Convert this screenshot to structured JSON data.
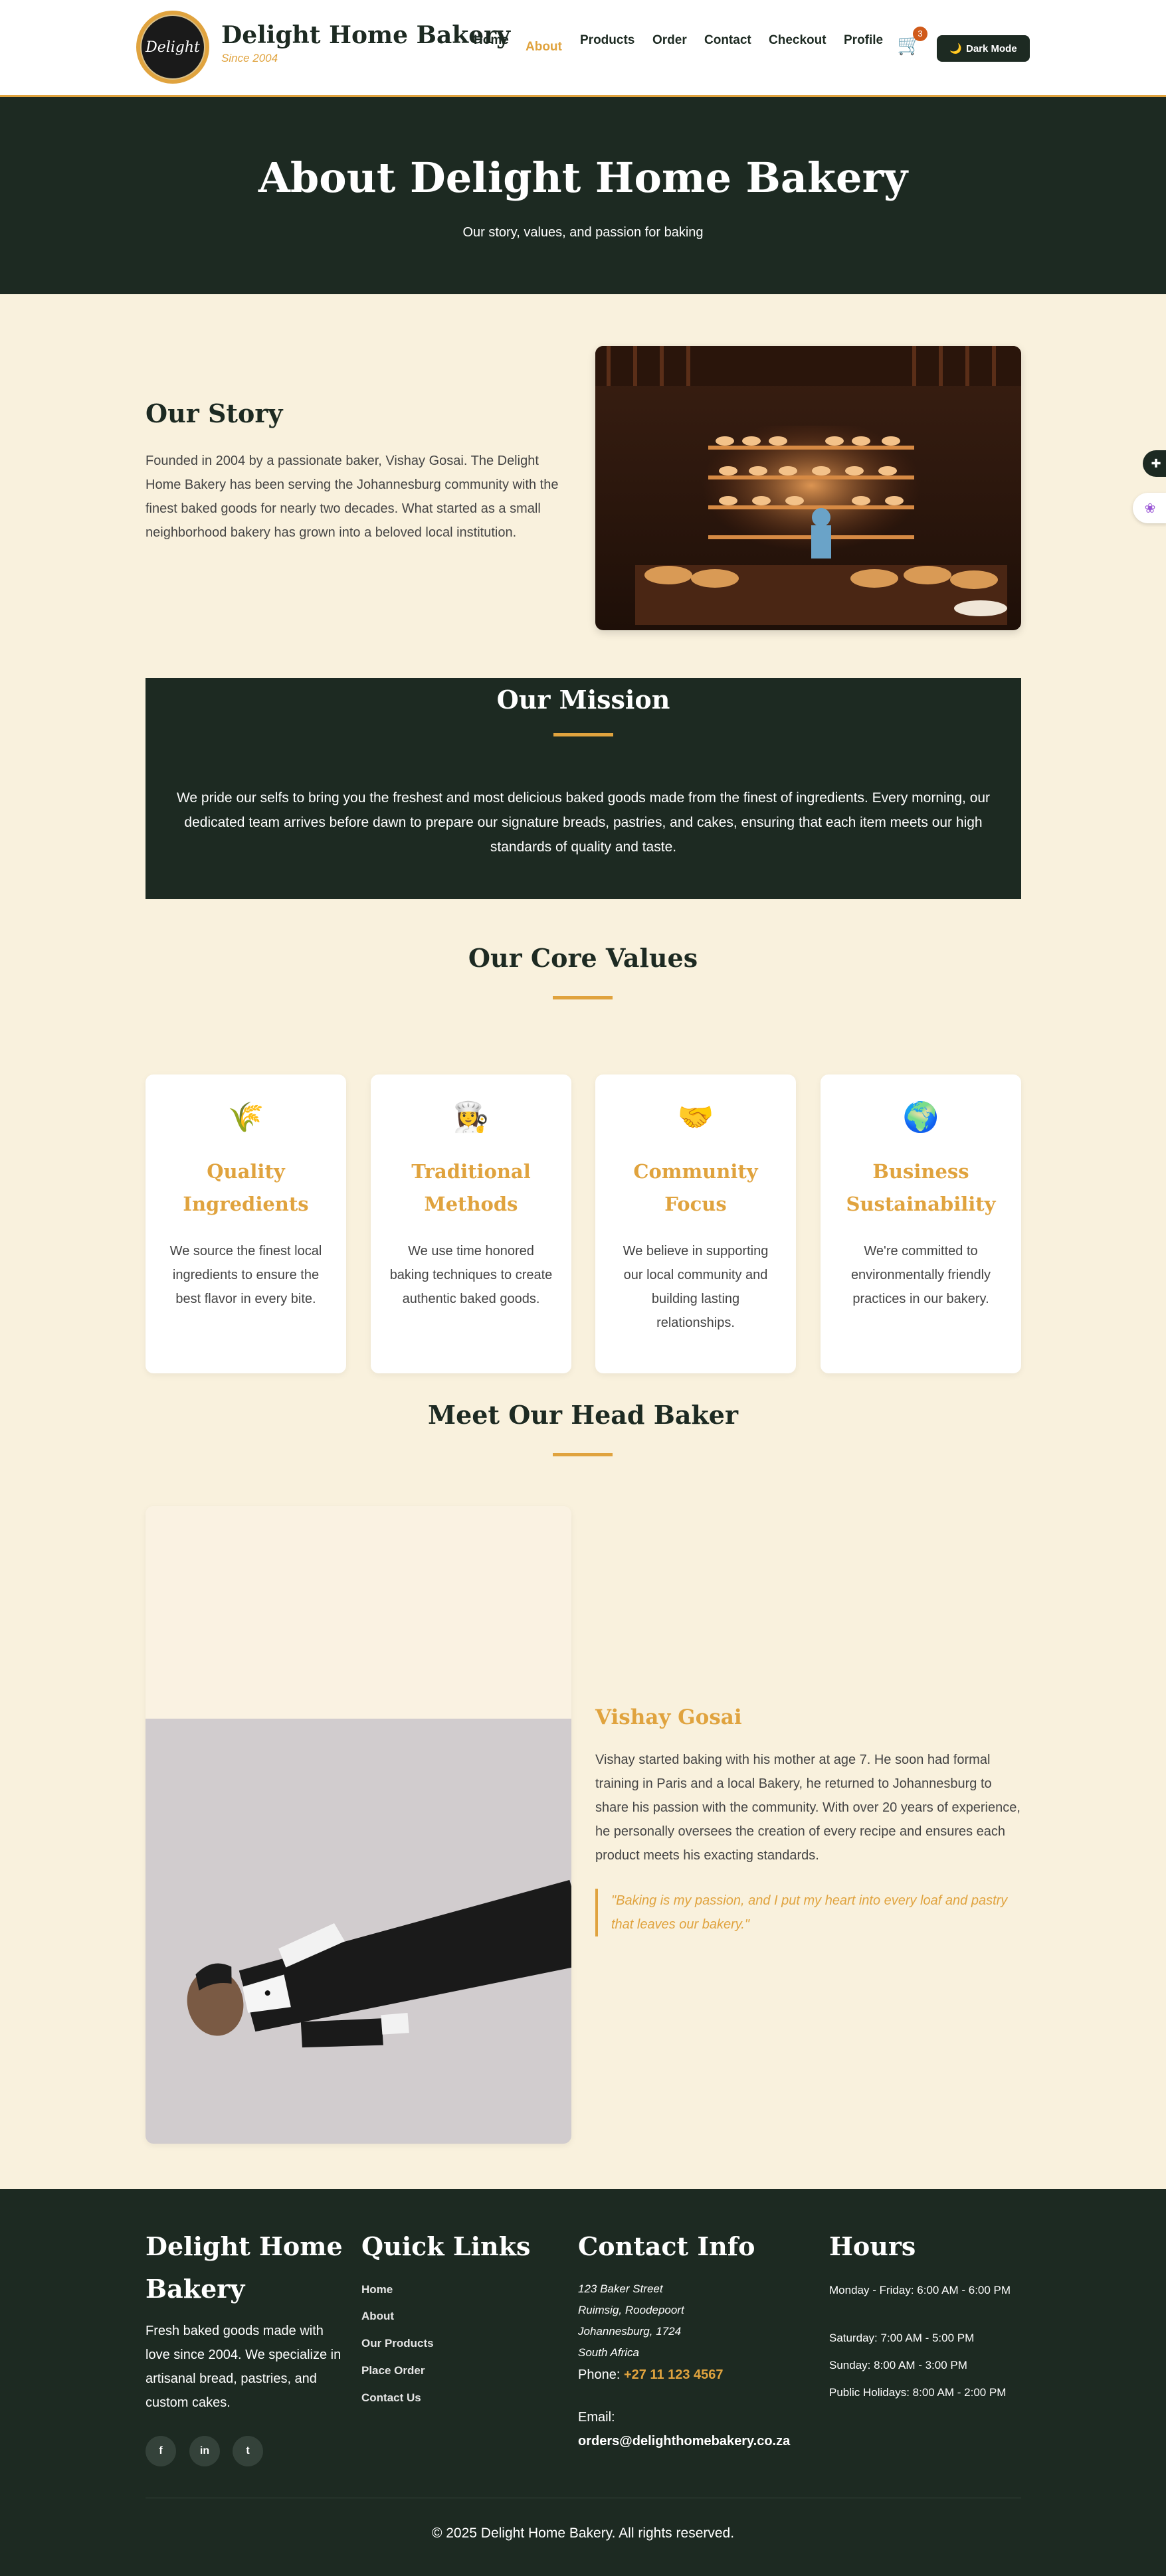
{
  "nav": {
    "logo_text": "Delight",
    "brand_name": "Delight Home Bakery",
    "since": "Since 2004",
    "links": [
      "Home",
      "About",
      "Products",
      "Order",
      "Contact",
      "Checkout",
      "Profile"
    ],
    "active_link": "About",
    "cart_count": "3",
    "dark_mode_label": "Dark Mode"
  },
  "hero": {
    "title": "About Delight Home Bakery",
    "subtitle": "Our story, values, and passion for baking"
  },
  "story": {
    "title": "Our Story",
    "text": "Founded in 2004 by a passionate baker, Vishay Gosai. The Delight Home Bakery has been serving the Johannesburg community with the finest baked goods for nearly two decades. What started as a small neighborhood bakery has grown into a beloved local institution."
  },
  "mission": {
    "title": "Our Mission",
    "text": "We pride our selfs to bring you the freshest and most delicious baked goods made from the finest of ingredients. Every morning, our dedicated team arrives before dawn to prepare our signature breads, pastries, and cakes, ensuring that each item meets our high standards of quality and taste."
  },
  "values": {
    "title": "Our Core Values",
    "cards": [
      {
        "icon": "🌾",
        "icon_name": "wheat-icon",
        "title": "Quality Ingredients",
        "text": "We source the finest local ingredients to ensure the best flavor in every bite."
      },
      {
        "icon": "👩‍🍳",
        "icon_name": "chef-icon",
        "title": "Traditional Methods",
        "text": "We use time honored baking techniques to create authentic baked goods."
      },
      {
        "icon": "🤝",
        "icon_name": "handshake-icon",
        "title": "Community Focus",
        "text": "We believe in supporting our local community and building lasting relationships."
      },
      {
        "icon": "🌍",
        "icon_name": "globe-icon",
        "title": "Business Sustainability",
        "text": "We're committed to environmentally friendly practices in our bakery."
      }
    ]
  },
  "baker": {
    "section_title": "Meet Our Head Baker",
    "name": "Vishay Gosai",
    "bio": "Vishay started baking with his mother at age 7. He soon had formal training in Paris and a local Bakery, he returned to Johannesburg to share his passion with the community. With over 20 years of experience, he personally oversees the creation of every recipe and ensures each product meets his exacting standards.",
    "quote": "\"Baking is my passion, and I put my heart into every loaf and pastry that leaves our bakery.\""
  },
  "footer": {
    "brand_title_line1": "Delight Home",
    "brand_title_line2": "Bakery",
    "brand_text": "Fresh baked goods made with love since 2004. We specialize in artisanal bread, pastries, and custom cakes.",
    "social": [
      "f",
      "in",
      "t"
    ],
    "quick_links_title": "Quick Links",
    "quick_links": [
      "Home",
      "About",
      "Our Products",
      "Place Order",
      "Contact Us"
    ],
    "contact_title": "Contact Info",
    "address": [
      "123 Baker Street",
      "Ruimsig, Roodepoort",
      "Johannesburg, 1724",
      "South Africa"
    ],
    "phone_label": "Phone:",
    "phone": "+27 11 123 4567",
    "email_label": "Email:",
    "email": "orders@delighthomebakery.co.za",
    "hours_title": "Hours",
    "hours": [
      "Monday - Friday: 6:00 AM - 6:00 PM",
      "Saturday: 7:00 AM - 5:00 PM",
      "Sunday: 8:00 AM - 3:00 PM",
      "Public Holidays: 8:00 AM - 2:00 PM"
    ],
    "copyright": "© 2025 Delight Home Bakery. All rights reserved."
  },
  "colors": {
    "primary_dark": "#1d2a22",
    "accent_gold": "#e0a33e",
    "background_cream": "#f9f1dd"
  }
}
